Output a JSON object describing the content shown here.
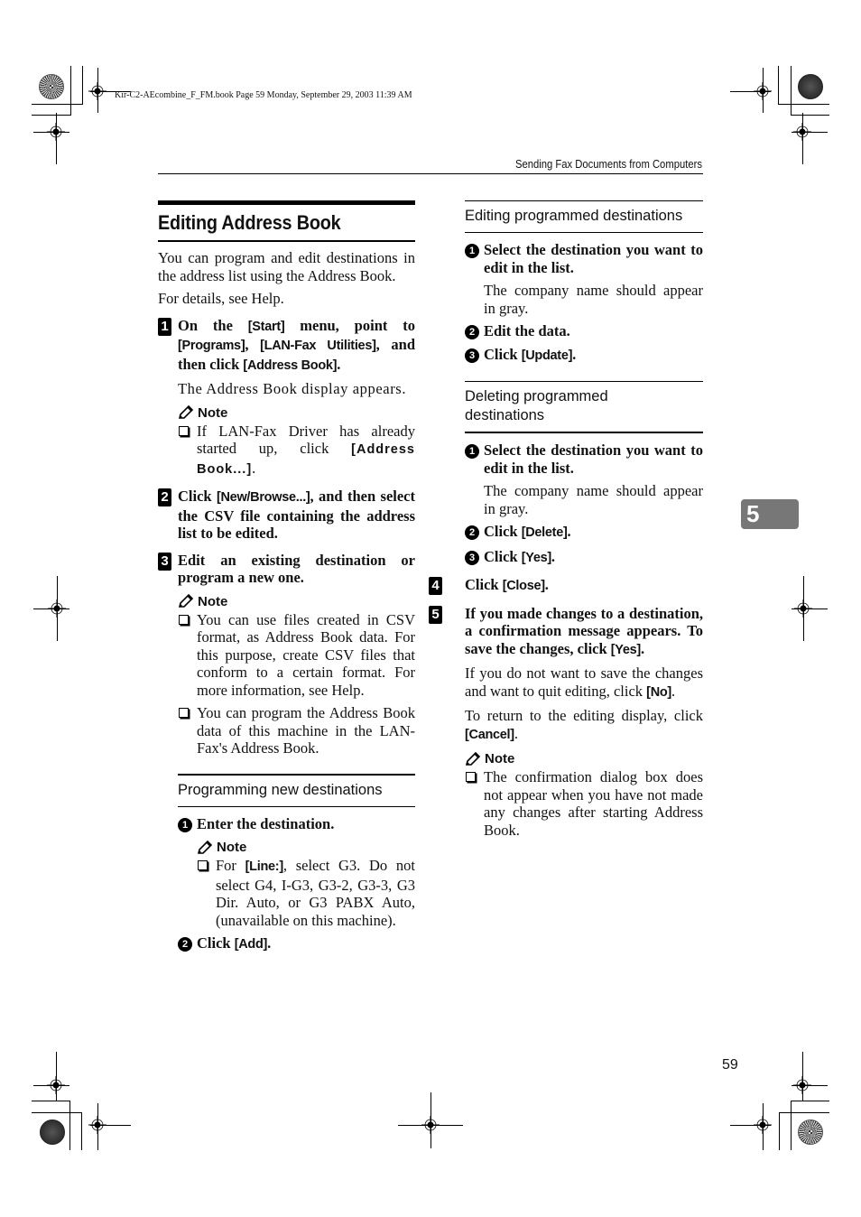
{
  "print_info": "Kir-C2-AEcombine_F_FM.book  Page 59  Monday, September 29, 2003  11:39 AM",
  "running_head": "Sending Fax Documents from Computers",
  "chapter_tab": "5",
  "page_number": "59",
  "left_column": {
    "title": "Editing Address Book",
    "intro": [
      "You can program and edit destinations in the address list using the Address Book.",
      "For details, see Help."
    ],
    "step1": {
      "num": "1",
      "t1": "On the ",
      "u1": "[Start]",
      "t2": " menu, point to ",
      "u2": "[Programs]",
      "t3": ", ",
      "u3": "[LAN-Fax Utilities]",
      "t4": ", and then click ",
      "u4": "[Address Book]",
      "t5": ".",
      "body": "The Address Book display appears.",
      "note_label": "Note",
      "note_items": [
        {
          "t1": "If LAN-Fax Driver has already started up, click ",
          "u1": "[Address Book...]",
          "t2": "."
        }
      ]
    },
    "step2": {
      "num": "2",
      "t1": "Click ",
      "u1": "[New/Browse...]",
      "t2": ", and then select the CSV file containing the address list to be edited."
    },
    "step3": {
      "num": "3",
      "title": "Edit an existing destination or program a new one.",
      "note_label": "Note",
      "note_items": [
        "You can use files created in CSV format, as Address Book data. For this purpose, create CSV files that conform to a certain format. For more information, see Help.",
        "You can program the Address Book data of this machine in the LAN-Fax's Address Book."
      ]
    },
    "programming": {
      "heading": "Programming new destinations",
      "sub1": {
        "num": "1",
        "title": "Enter the destination.",
        "note_label": "Note",
        "note": {
          "t1": "For ",
          "u1": "[Line:]",
          "t2": ", select G3. Do not select G4, I-G3, G3-2, G3-3, G3 Dir. Auto, or G3 PABX Auto, (unavailable on this machine)."
        }
      },
      "sub2": {
        "num": "2",
        "t1": "Click ",
        "u1": "[Add]",
        "t2": "."
      }
    }
  },
  "right_column": {
    "editing": {
      "heading": "Editing programmed destinations",
      "sub1": {
        "num": "1",
        "title": "Select the destination you want to edit in the list.",
        "body": "The company name should appear in gray."
      },
      "sub2": {
        "num": "2",
        "title": "Edit the data."
      },
      "sub3": {
        "num": "3",
        "t1": "Click ",
        "u1": "[Update]",
        "t2": "."
      }
    },
    "deleting": {
      "heading": "Deleting programmed destinations",
      "sub1": {
        "num": "1",
        "title": "Select the destination you want to edit in the list.",
        "body": "The company name should appear in gray."
      },
      "sub2": {
        "num": "2",
        "t1": "Click ",
        "u1": "[Delete]",
        "t2": "."
      },
      "sub3": {
        "num": "3",
        "t1": "Click ",
        "u1": "[Yes]",
        "t2": "."
      }
    },
    "step4": {
      "num": "4",
      "t1": "Click ",
      "u1": "[Close]",
      "t2": "."
    },
    "step5": {
      "num": "5",
      "t1": "If you made changes to a destination, a confirmation message appears. To save the changes, click ",
      "u1": "[Yes]",
      "t2": ".",
      "para1": {
        "t1": "If you do not want to save the changes and want to quit editing, click ",
        "u1": "[No]",
        "t2": "."
      },
      "para2": {
        "t1": "To return to the editing display, click ",
        "u1": "[Cancel]",
        "t2": "."
      },
      "note_label": "Note",
      "note_items": [
        "The confirmation dialog box does not appear when you have not made any changes after starting Address Book."
      ]
    }
  }
}
